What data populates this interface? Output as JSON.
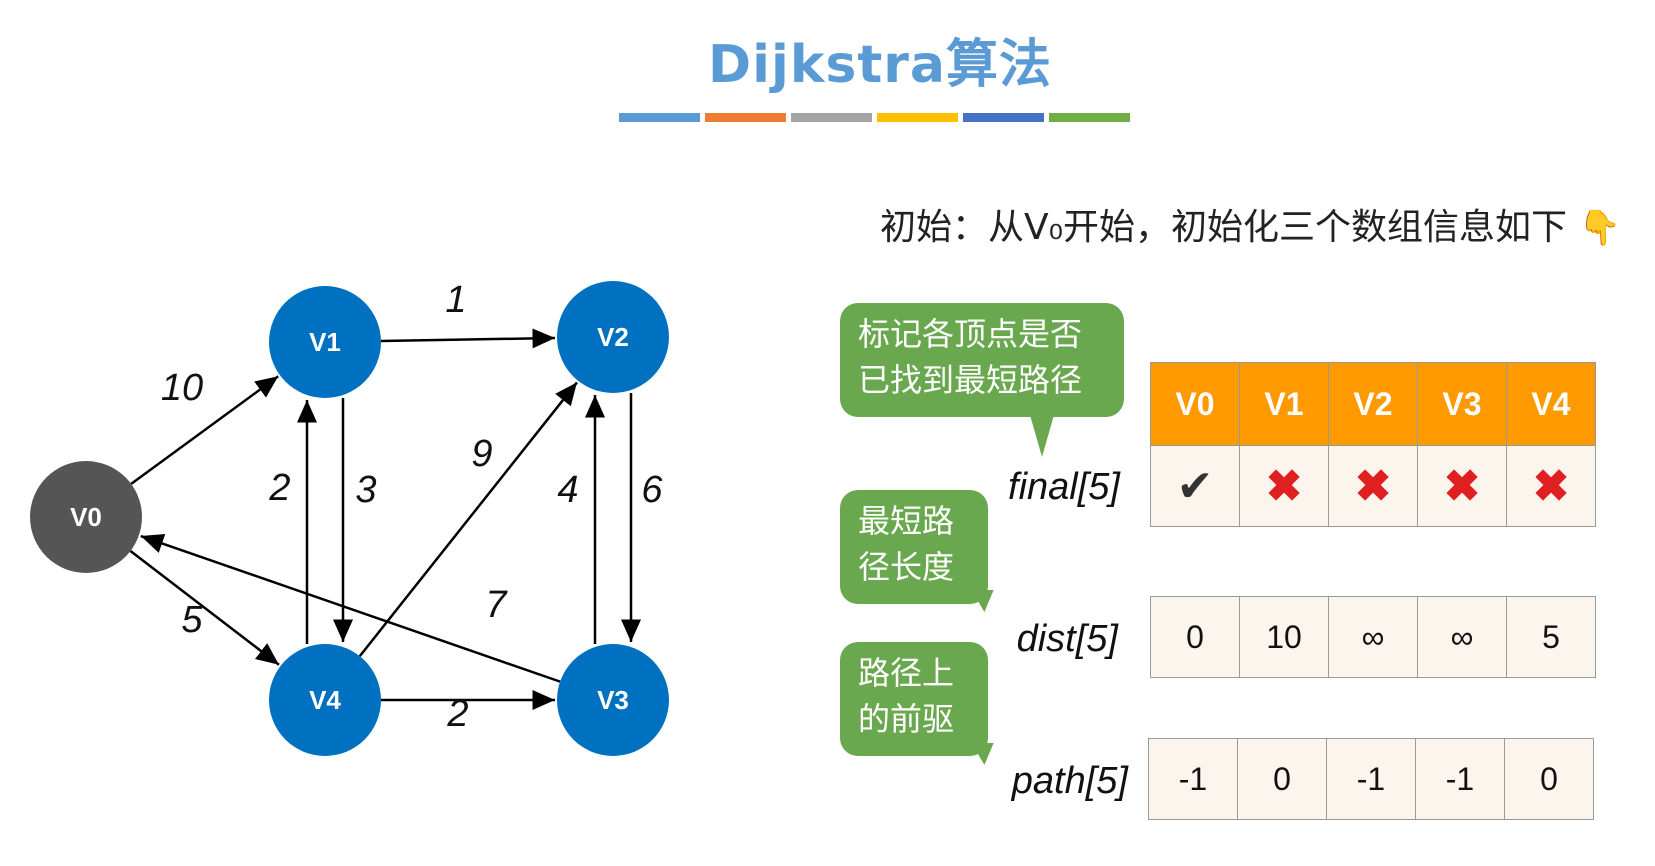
{
  "title": "Dijkstra算法",
  "color_bar": [
    "#5b9bd5",
    "#ed7d31",
    "#a5a5a5",
    "#ffc000",
    "#4472c4",
    "#70ad47"
  ],
  "subtitle": "初始：从V₀开始，初始化三个数组信息如下",
  "subtitle_emoji": "👇",
  "graph": {
    "nodes": [
      {
        "id": "V0",
        "label": "V0",
        "color": "#555555"
      },
      {
        "id": "V1",
        "label": "V1",
        "color": "#0070c0"
      },
      {
        "id": "V2",
        "label": "V2",
        "color": "#0070c0"
      },
      {
        "id": "V3",
        "label": "V3",
        "color": "#0070c0"
      },
      {
        "id": "V4",
        "label": "V4",
        "color": "#0070c0"
      }
    ],
    "edges": [
      {
        "from": "V0",
        "to": "V1",
        "weight": "10"
      },
      {
        "from": "V0",
        "to": "V4",
        "weight": "5"
      },
      {
        "from": "V1",
        "to": "V2",
        "weight": "1"
      },
      {
        "from": "V1",
        "to": "V4",
        "weight": "2"
      },
      {
        "from": "V4",
        "to": "V1",
        "weight": "3"
      },
      {
        "from": "V4",
        "to": "V2",
        "weight": "9"
      },
      {
        "from": "V2",
        "to": "V3",
        "weight": "4"
      },
      {
        "from": "V3",
        "to": "V2",
        "weight": "6"
      },
      {
        "from": "V3",
        "to": "V0",
        "weight": "7"
      },
      {
        "from": "V4",
        "to": "V3",
        "weight": "2"
      }
    ]
  },
  "callouts": {
    "final": "标记各顶点是否已找到最短路径",
    "dist": "最短路径长度",
    "path": "路径上的前驱"
  },
  "table": {
    "headers": [
      "V0",
      "V1",
      "V2",
      "V3",
      "V4"
    ],
    "final": {
      "label": "final[5]",
      "values": [
        "✔",
        "✖",
        "✖",
        "✖",
        "✖"
      ]
    },
    "dist": {
      "label": "dist[5]",
      "values": [
        "0",
        "10",
        "∞",
        "∞",
        "5"
      ]
    },
    "path": {
      "label": "path[5]",
      "values": [
        "-1",
        "0",
        "-1",
        "-1",
        "0"
      ]
    }
  }
}
